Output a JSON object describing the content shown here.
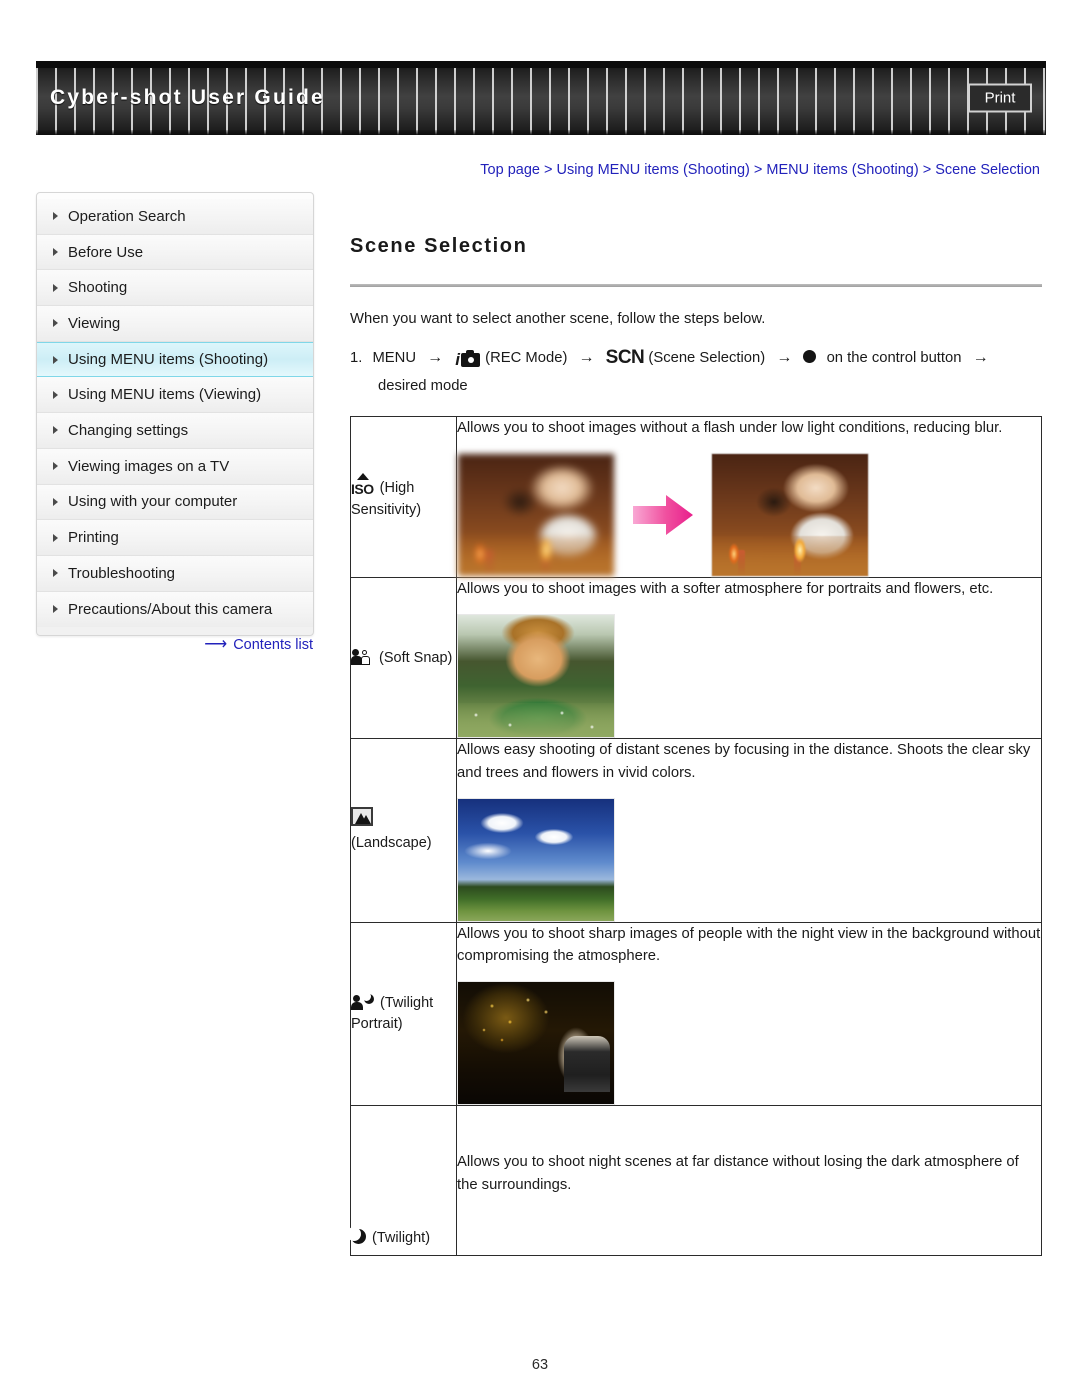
{
  "header": {
    "title": "Cyber-shot User Guide",
    "print_label": "Print"
  },
  "breadcrumb": {
    "text": "Top page > Using MENU items (Shooting) > MENU items (Shooting) > Scene Selection"
  },
  "sidebar": {
    "items": [
      {
        "label": "Operation Search",
        "active": false
      },
      {
        "label": "Before Use",
        "active": false
      },
      {
        "label": "Shooting",
        "active": false
      },
      {
        "label": "Viewing",
        "active": false
      },
      {
        "label": "Using MENU items (Shooting)",
        "active": true
      },
      {
        "label": "Using MENU items (Viewing)",
        "active": false
      },
      {
        "label": "Changing settings",
        "active": false
      },
      {
        "label": "Viewing images on a TV",
        "active": false
      },
      {
        "label": "Using with your computer",
        "active": false
      },
      {
        "label": "Printing",
        "active": false
      },
      {
        "label": "Troubleshooting",
        "active": false
      },
      {
        "label": "Precautions/About this camera",
        "active": false
      }
    ],
    "contents_link": "Contents list",
    "contents_arrow": "⟶"
  },
  "main": {
    "page_title": "Scene Selection",
    "intro": "When you want to select another scene, follow the steps below.",
    "step": {
      "number": "1.",
      "menu_label": "MENU",
      "arrow": "→",
      "rec_mode_letter": "i",
      "rec_mode_label": "(REC Mode)",
      "scn_icon": "SCN",
      "scn_label": "(Scene Selection)",
      "control_button_label": "on the control button",
      "desired_mode": "desired mode"
    },
    "table": {
      "rows": [
        {
          "icon_name": "iso-high-sensitivity-icon",
          "icon_text": "ISO",
          "label": "(High Sensitivity)",
          "description": "Allows you to shoot images without a flash under low light conditions, reducing blur.",
          "photos": 2,
          "arrow_between": true
        },
        {
          "icon_name": "soft-snap-icon",
          "icon_text": "",
          "label": "(Soft Snap)",
          "description": "Allows you to shoot images with a softer atmosphere for portraits and flowers, etc.",
          "photos": 1,
          "arrow_between": false
        },
        {
          "icon_name": "landscape-icon",
          "icon_text": "",
          "label": "(Landscape)",
          "description": "Allows easy shooting of distant scenes by focusing in the distance. Shoots the clear sky and trees and flowers in vivid colors.",
          "photos": 1,
          "arrow_between": false
        },
        {
          "icon_name": "twilight-portrait-icon",
          "icon_text": "",
          "label": "(Twilight Portrait)",
          "description": "Allows you to shoot sharp images of people with the night view in the background without compromising the atmosphere.",
          "photos": 1,
          "arrow_between": false
        },
        {
          "icon_name": "twilight-icon",
          "icon_text": "",
          "label": "(Twilight)",
          "description": "Allows you to shoot night scenes at far distance without losing the dark atmosphere of the surroundings.",
          "photos": 0,
          "arrow_between": false
        }
      ]
    }
  },
  "footer": {
    "page_number": "63"
  },
  "colors": {
    "link": "#2222bb",
    "header_bg": "#2e2e2e",
    "active_nav": "#cdeef6",
    "arrow_pink": "#ee3f96"
  }
}
